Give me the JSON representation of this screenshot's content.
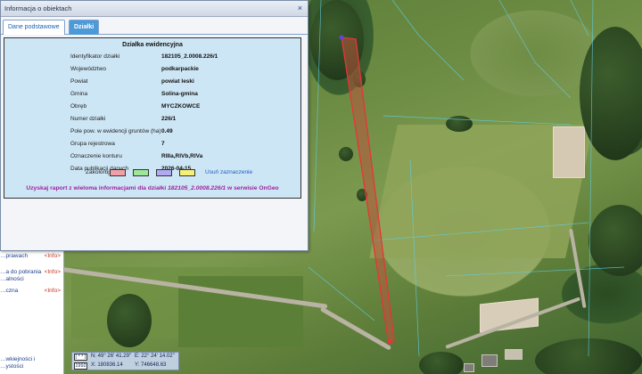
{
  "dialog": {
    "title": "Informacja o obiektach",
    "close_label": "×",
    "tabs": [
      {
        "label": "Dane podstawowe",
        "active": false
      },
      {
        "label": "Działki",
        "active": true
      }
    ]
  },
  "parcel": {
    "heading": "Działka ewidencyjna",
    "fields": [
      {
        "label": "Identyfikator działki",
        "value": "182105_2.0008.226/1"
      },
      {
        "label": "Województwo",
        "value": "podkarpackie"
      },
      {
        "label": "Powiat",
        "value": "powiat leski"
      },
      {
        "label": "Gmina",
        "value": "Solina-gmina"
      },
      {
        "label": "Obręb",
        "value": "MYCZKOWCE"
      },
      {
        "label": "Numer działki",
        "value": "226/1"
      },
      {
        "label": "Pole pow. w ewidencji gruntów (ha)",
        "value": "0.49"
      },
      {
        "label": "Grupa rejestrowa",
        "value": "7"
      },
      {
        "label": "Oznaczenie konturu",
        "value": "RIIIa,RIVb,RIVa"
      },
      {
        "label": "Data publikacji danych",
        "value": "2026-04-15"
      }
    ],
    "color_label": "Zakoloruj:",
    "colors": [
      "#f2a0a8",
      "#9ee79a",
      "#b0aaf0",
      "#f4f07a"
    ],
    "clear_label": "Usuń zaznaczenie",
    "report_prefix": "Uzyskaj raport z wieloma informacjami dla działki ",
    "report_id": "182105_2.0008.226/1",
    "report_suffix": " w serwisie OnGeo"
  },
  "sidebar": {
    "items": [
      {
        "label": "…prawach",
        "info": "<Info>"
      },
      {
        "label": "…a do pobrania\n…alności",
        "info": "<Info>"
      },
      {
        "label": "…czna",
        "info": "<Info>"
      }
    ],
    "bottom_text": "…wkiejności i\n…ystości"
  },
  "coordinates": {
    "crs_top": "[ * * ]",
    "crs_bottom": "1992",
    "n": "N:  49° 26' 41.29\"",
    "e": "E:  22° 24' 14.02\"",
    "x": "X:  180836.14",
    "y": "Y:  746648.63"
  },
  "colors": {
    "parcel_outline": "#e8343a",
    "parcel_fill": "#b8563c",
    "tab_active": "#4d9ad8",
    "card_bg": "#cde6f5",
    "report_link": "#a0229c"
  }
}
